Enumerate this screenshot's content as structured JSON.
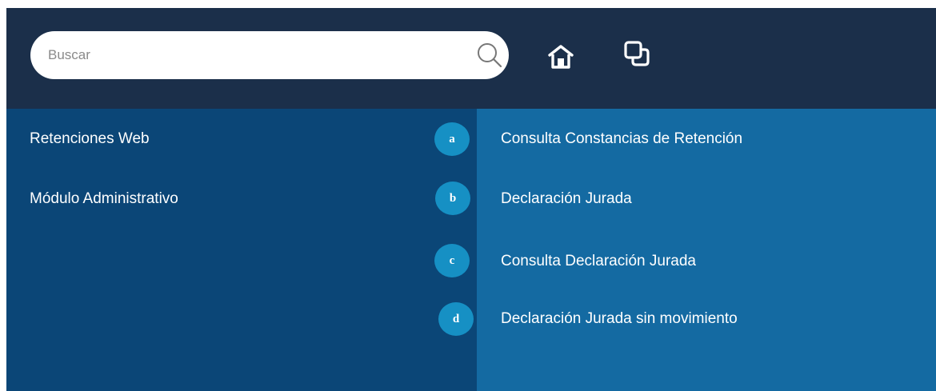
{
  "search": {
    "placeholder": "Buscar",
    "value": ""
  },
  "icons": {
    "search": "search-icon",
    "home": "home-icon",
    "window": "window-icon"
  },
  "sidebar": {
    "items": [
      {
        "label": "Retenciones Web"
      },
      {
        "label": "Módulo Administrativo"
      }
    ]
  },
  "submenu": {
    "items": [
      {
        "badge": "a",
        "label": "Consulta Constancias de Retención"
      },
      {
        "badge": "b",
        "label": "Declaración Jurada"
      },
      {
        "badge": "c",
        "label": "Consulta Declaración Jurada"
      },
      {
        "badge": "d",
        "label": "Declaración Jurada sin movimiento"
      }
    ]
  },
  "colors": {
    "header_bg": "#1b2f4a",
    "left_panel_bg": "#0b4677",
    "right_panel_bg": "#146aa2",
    "badge_bg": "#1690c4",
    "text": "#ffffff"
  }
}
